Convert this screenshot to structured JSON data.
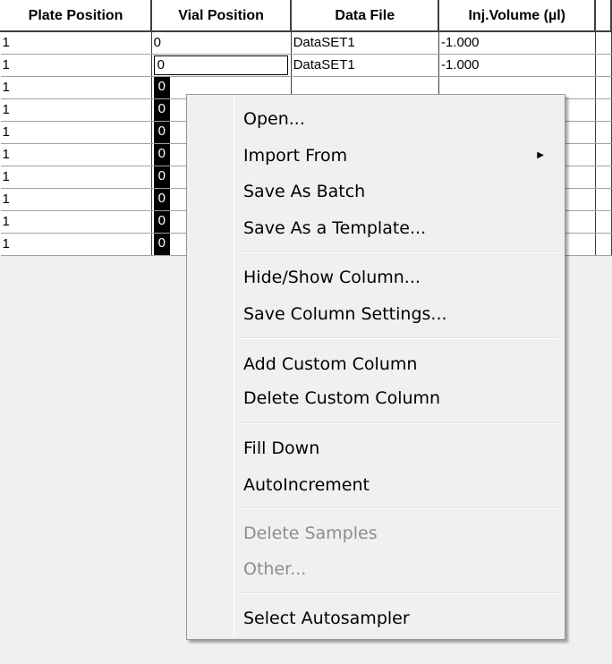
{
  "columns": {
    "plate": "Plate Position",
    "vial": "Vial Position",
    "file": "Data File",
    "inj": "Inj.Volume (µl)"
  },
  "rows": [
    {
      "plate": "1",
      "vial": "0",
      "file": "DataSET1",
      "inj": "-1.000"
    },
    {
      "plate": "1",
      "vial": "0",
      "file": "DataSET1",
      "inj": "-1.000"
    },
    {
      "plate": "1",
      "vial": "0",
      "file": "",
      "inj": ""
    },
    {
      "plate": "1",
      "vial": "0",
      "file": "",
      "inj": ""
    },
    {
      "plate": "1",
      "vial": "0",
      "file": "",
      "inj": ""
    },
    {
      "plate": "1",
      "vial": "0",
      "file": "",
      "inj": ""
    },
    {
      "plate": "1",
      "vial": "0",
      "file": "",
      "inj": ""
    },
    {
      "plate": "1",
      "vial": "0",
      "file": "",
      "inj": ""
    },
    {
      "plate": "1",
      "vial": "0",
      "file": "",
      "inj": ""
    },
    {
      "plate": "1",
      "vial": "0",
      "file": "",
      "inj": ""
    }
  ],
  "menu": {
    "open": "Open...",
    "import_from": "Import From",
    "save_as_batch": "Save As Batch",
    "save_as_template": "Save As a Template...",
    "hide_show_column": "Hide/Show Column...",
    "save_column_settings": "Save Column Settings...",
    "add_custom_column": "Add Custom Column",
    "delete_custom_column": "Delete Custom Column",
    "fill_down": "Fill Down",
    "autoincrement": "AutoIncrement",
    "delete_samples": "Delete Samples",
    "other": "Other...",
    "select_autosampler": "Select Autosampler",
    "submenu_icon": "submenu-arrow-icon"
  },
  "colors": {
    "selection": "#000000",
    "menu_bg": "#f0f0f0",
    "disabled_text": "#8d8d8d"
  }
}
